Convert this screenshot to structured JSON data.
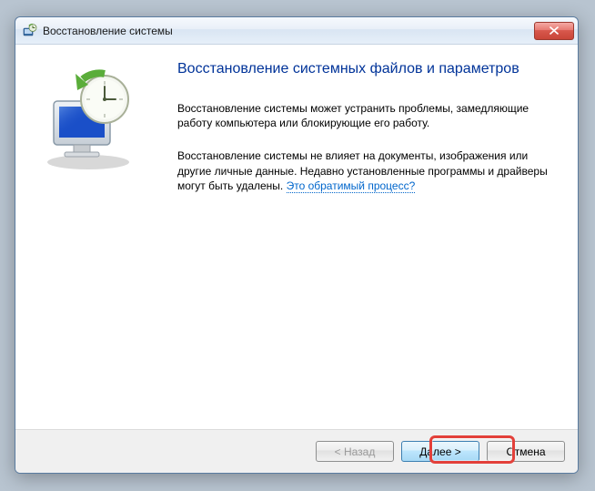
{
  "titlebar": {
    "title": "Восстановление системы"
  },
  "content": {
    "heading": "Восстановление системных файлов и параметров",
    "paragraph1": "Восстановление системы может устранить проблемы, замедляющие работу компьютера или блокирующие его работу.",
    "paragraph2a": "Восстановление системы не влияет на документы, изображения или другие личные данные. Недавно установленные программы и драйверы могут быть удалены. ",
    "link_text": "Это обратимый процесс?"
  },
  "buttons": {
    "back": "< Назад",
    "next": "Далее >",
    "cancel": "Отмена"
  },
  "icons": {
    "title_icon": "system-restore",
    "close": "close"
  }
}
